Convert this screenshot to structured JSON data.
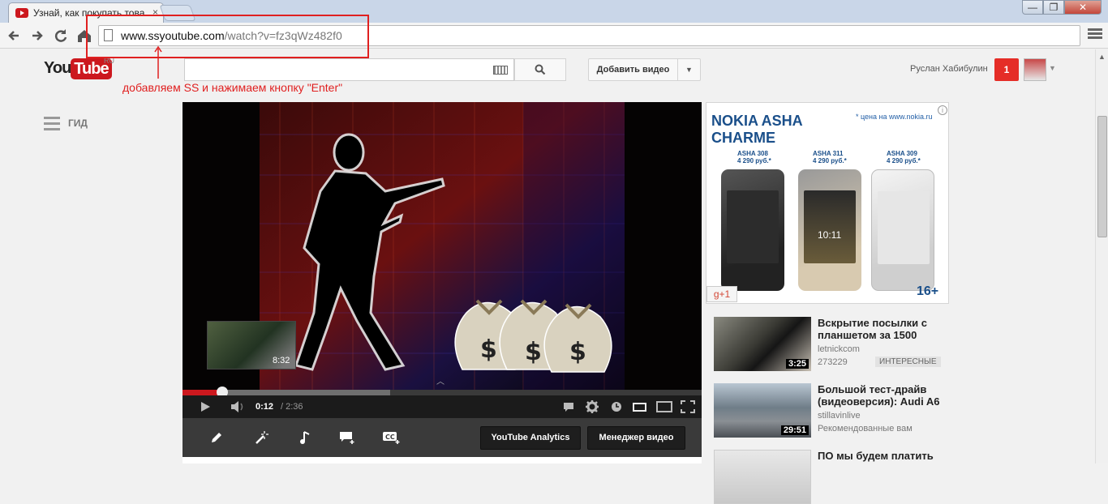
{
  "browser": {
    "tab_title": "Узнай, как покупать това",
    "tab_close": "×",
    "window_min": "—",
    "window_max": "❐",
    "window_close": "✕",
    "url_host": "www.ssyoutube.com",
    "url_path": "/watch?v=fz3qWz482f0"
  },
  "annotation": {
    "text": "добавляем SS и нажимаем кнопку \"Enter\"",
    "color": "#e02020"
  },
  "header": {
    "logo_you": "You",
    "logo_tube": "Tube",
    "logo_region": "RU",
    "search_placeholder": "",
    "search_icon": "search-icon",
    "upload_label": "Добавить видео",
    "user_name": "Руслан Хабибулин",
    "notifications": "1"
  },
  "guide": {
    "label": "ГИД"
  },
  "player": {
    "time_current": "0:12",
    "time_total": "/ 2:36",
    "preview_time": "8:32",
    "played_fraction": 0.077,
    "buffered_fraction": 0.4,
    "brand_color": "#cc181e"
  },
  "toolbar": {
    "analytics_label": "YouTube Analytics",
    "manager_label": "Менеджер видео",
    "tools": [
      "pencil-icon",
      "magic-wand-icon",
      "music-icon",
      "annotation-icon",
      "captions-icon"
    ]
  },
  "ad": {
    "brand": "NOKIA ASHA\nCHARME",
    "price_site": "* цена на www.nokia.ru",
    "info": "i",
    "models": [
      {
        "name": "ASHA 308",
        "price": "4 290 руб.*"
      },
      {
        "name": "ASHA 311",
        "price": "4 290 руб.*"
      },
      {
        "name": "ASHA 309",
        "price": "4 290 руб.*"
      }
    ],
    "clock": "10:11",
    "age": "16+",
    "gplus": "g+1"
  },
  "related": [
    {
      "title": "Вскрытие посылки с планшетом за 1500",
      "channel": "letnickcom",
      "views": "273229",
      "badge": "ИНТЕРЕСНЫЕ",
      "duration": "3:25"
    },
    {
      "title": "Большой тест-драйв (видеоверсия): Audi A6",
      "channel": "stillavinlive",
      "views": "Рекомендованные вам",
      "badge": "",
      "duration": "29:51"
    },
    {
      "title": "ПО мы будем платить",
      "channel": "",
      "views": "",
      "badge": "",
      "duration": ""
    }
  ]
}
